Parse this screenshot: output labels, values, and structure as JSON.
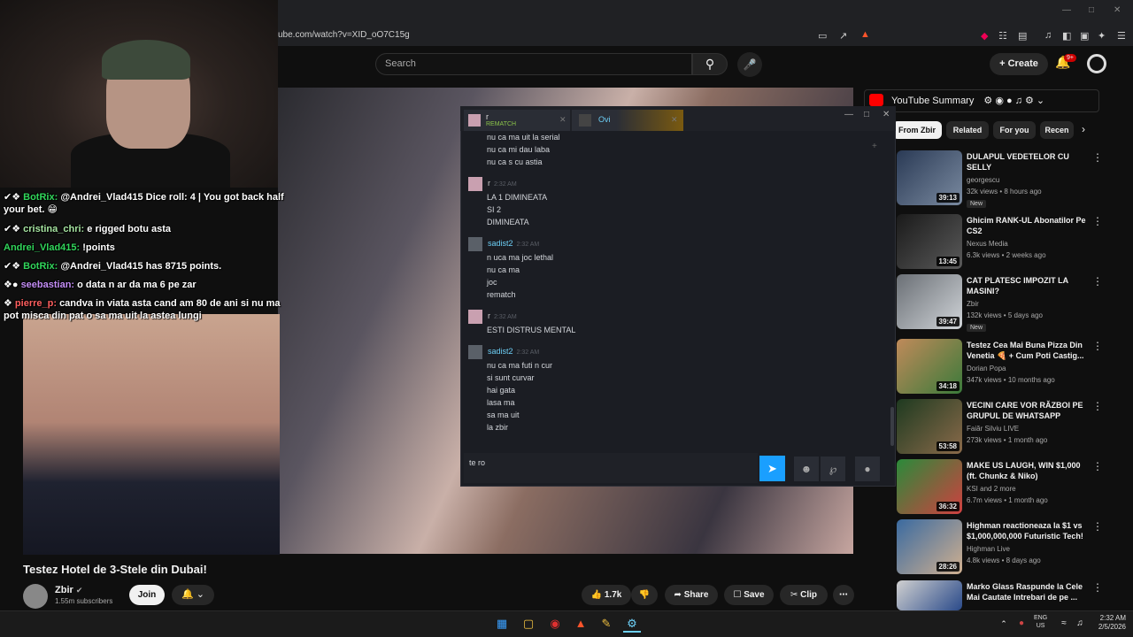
{
  "browser": {
    "url": "ube.com/watch?v=XID_oO7C15g"
  },
  "header": {
    "search_placeholder": "Search",
    "create_label": "Create",
    "notif_badge": "9+"
  },
  "video": {
    "title": "Testez Hotel de 3-Stele din Dubai!",
    "channel": "Zbir",
    "subscribers": "1.55m subscribers",
    "join_label": "Join",
    "likes": "1.7k",
    "share_label": "Share",
    "save_label": "Save",
    "clip_label": "Clip"
  },
  "twitch_chat": [
    {
      "user": "BotRix:",
      "text": "@Andrei_Vlad415 Dice roll: 4 | You got back half your bet. 😁"
    },
    {
      "user": "cristina_chri:",
      "text": "e rigged botu asta"
    },
    {
      "user": "Andrei_Vlad415:",
      "text": "!points"
    },
    {
      "user": "BotRix:",
      "text": "@Andrei_Vlad415 has 8715 points."
    },
    {
      "user": "seebastian:",
      "text": "o data n ar da ma 6 pe zar"
    },
    {
      "user": "pierre_p:",
      "text": "candva in viata asta cand am 80 de ani si nu ma pot misca din pat o sa ma uit la astea lungi"
    }
  ],
  "summary": {
    "label": "YouTube Summary"
  },
  "chips": [
    "From Zbir",
    "Related",
    "For you",
    "Recen"
  ],
  "related": [
    {
      "title": "DULAPUL VEDETELOR CU SELLY",
      "channel": "georgescu",
      "meta": "32k views • 8 hours ago",
      "duration": "39:13",
      "badge": "New"
    },
    {
      "title": "Ghicim RANK-UL Abonatilor Pe CS2",
      "channel": "Nexus Media",
      "meta": "6.3k views • 2 weeks ago",
      "duration": "13:45",
      "badge": ""
    },
    {
      "title": "CAT PLATESC IMPOZIT LA MASINI?",
      "channel": "Zbir",
      "meta": "132k views • 5 days ago",
      "duration": "39:47",
      "badge": "New"
    },
    {
      "title": "Testez Cea Mai Buna Pizza Din Venetia 🍕 + Cum Poti Castig...",
      "channel": "Dorian Popa",
      "meta": "347k views • 10 months ago",
      "duration": "34:18",
      "badge": ""
    },
    {
      "title": "VECINI CARE VOR RĂZBOI PE GRUPUL DE WHATSAPP",
      "channel": "Faiăr Silviu LIVE",
      "meta": "273k views • 1 month ago",
      "duration": "53:58",
      "badge": ""
    },
    {
      "title": "MAKE US LAUGH, WIN $1,000 (ft. Chunkz & Niko)",
      "channel": "KSI and 2 more",
      "meta": "6.7m views • 1 month ago",
      "duration": "36:32",
      "badge": ""
    },
    {
      "title": "Highman reactioneaza la $1 vs $1,000,000,000 Futuristic Tech!",
      "channel": "Highman Live",
      "meta": "4.8k views • 8 days ago",
      "duration": "28:26",
      "badge": ""
    },
    {
      "title": "Marko Glass Raspunde la Cele Mai Cautate Intrebari de pe ...",
      "channel": "",
      "meta": "",
      "duration": "",
      "badge": ""
    }
  ],
  "steam": {
    "tab1_name": "r",
    "tab1_status": "REMATCH",
    "tab2_name": "Ovi",
    "lines_top": [
      "nu ca ma uit la serial",
      "nu ca mi dau laba",
      "nu ca s cu astia"
    ],
    "msg1_name": "r",
    "msg1_time": "2:32 AM",
    "msg1_lines": [
      "LA 1 DIMINEATA",
      "SI 2",
      "DIMINEATA"
    ],
    "msg2_name": "sadist2",
    "msg2_time": "2:32 AM",
    "msg2_lines": [
      "n uca ma joc lethal",
      "nu ca ma",
      "joc",
      "rematch"
    ],
    "msg3_name": "r",
    "msg3_time": "2:32 AM",
    "msg3_lines": [
      "ESTI DISTRUS MENTAL"
    ],
    "msg4_name": "sadist2",
    "msg4_time": "2:32 AM",
    "msg4_lines": [
      "nu ca ma futi n cur",
      "si sunt curvar",
      "hai gata",
      "lasa ma",
      "sa ma uit",
      "la zbir"
    ],
    "input_value": "te ro"
  },
  "taskbar": {
    "lang1": "ENG",
    "lang2": "US",
    "time": "2:32 AM",
    "date": "2/5/2026"
  },
  "colors": {
    "accent": "#1a9fff",
    "youtube_red": "#ff0000",
    "steam_name": "#6dcff6"
  }
}
